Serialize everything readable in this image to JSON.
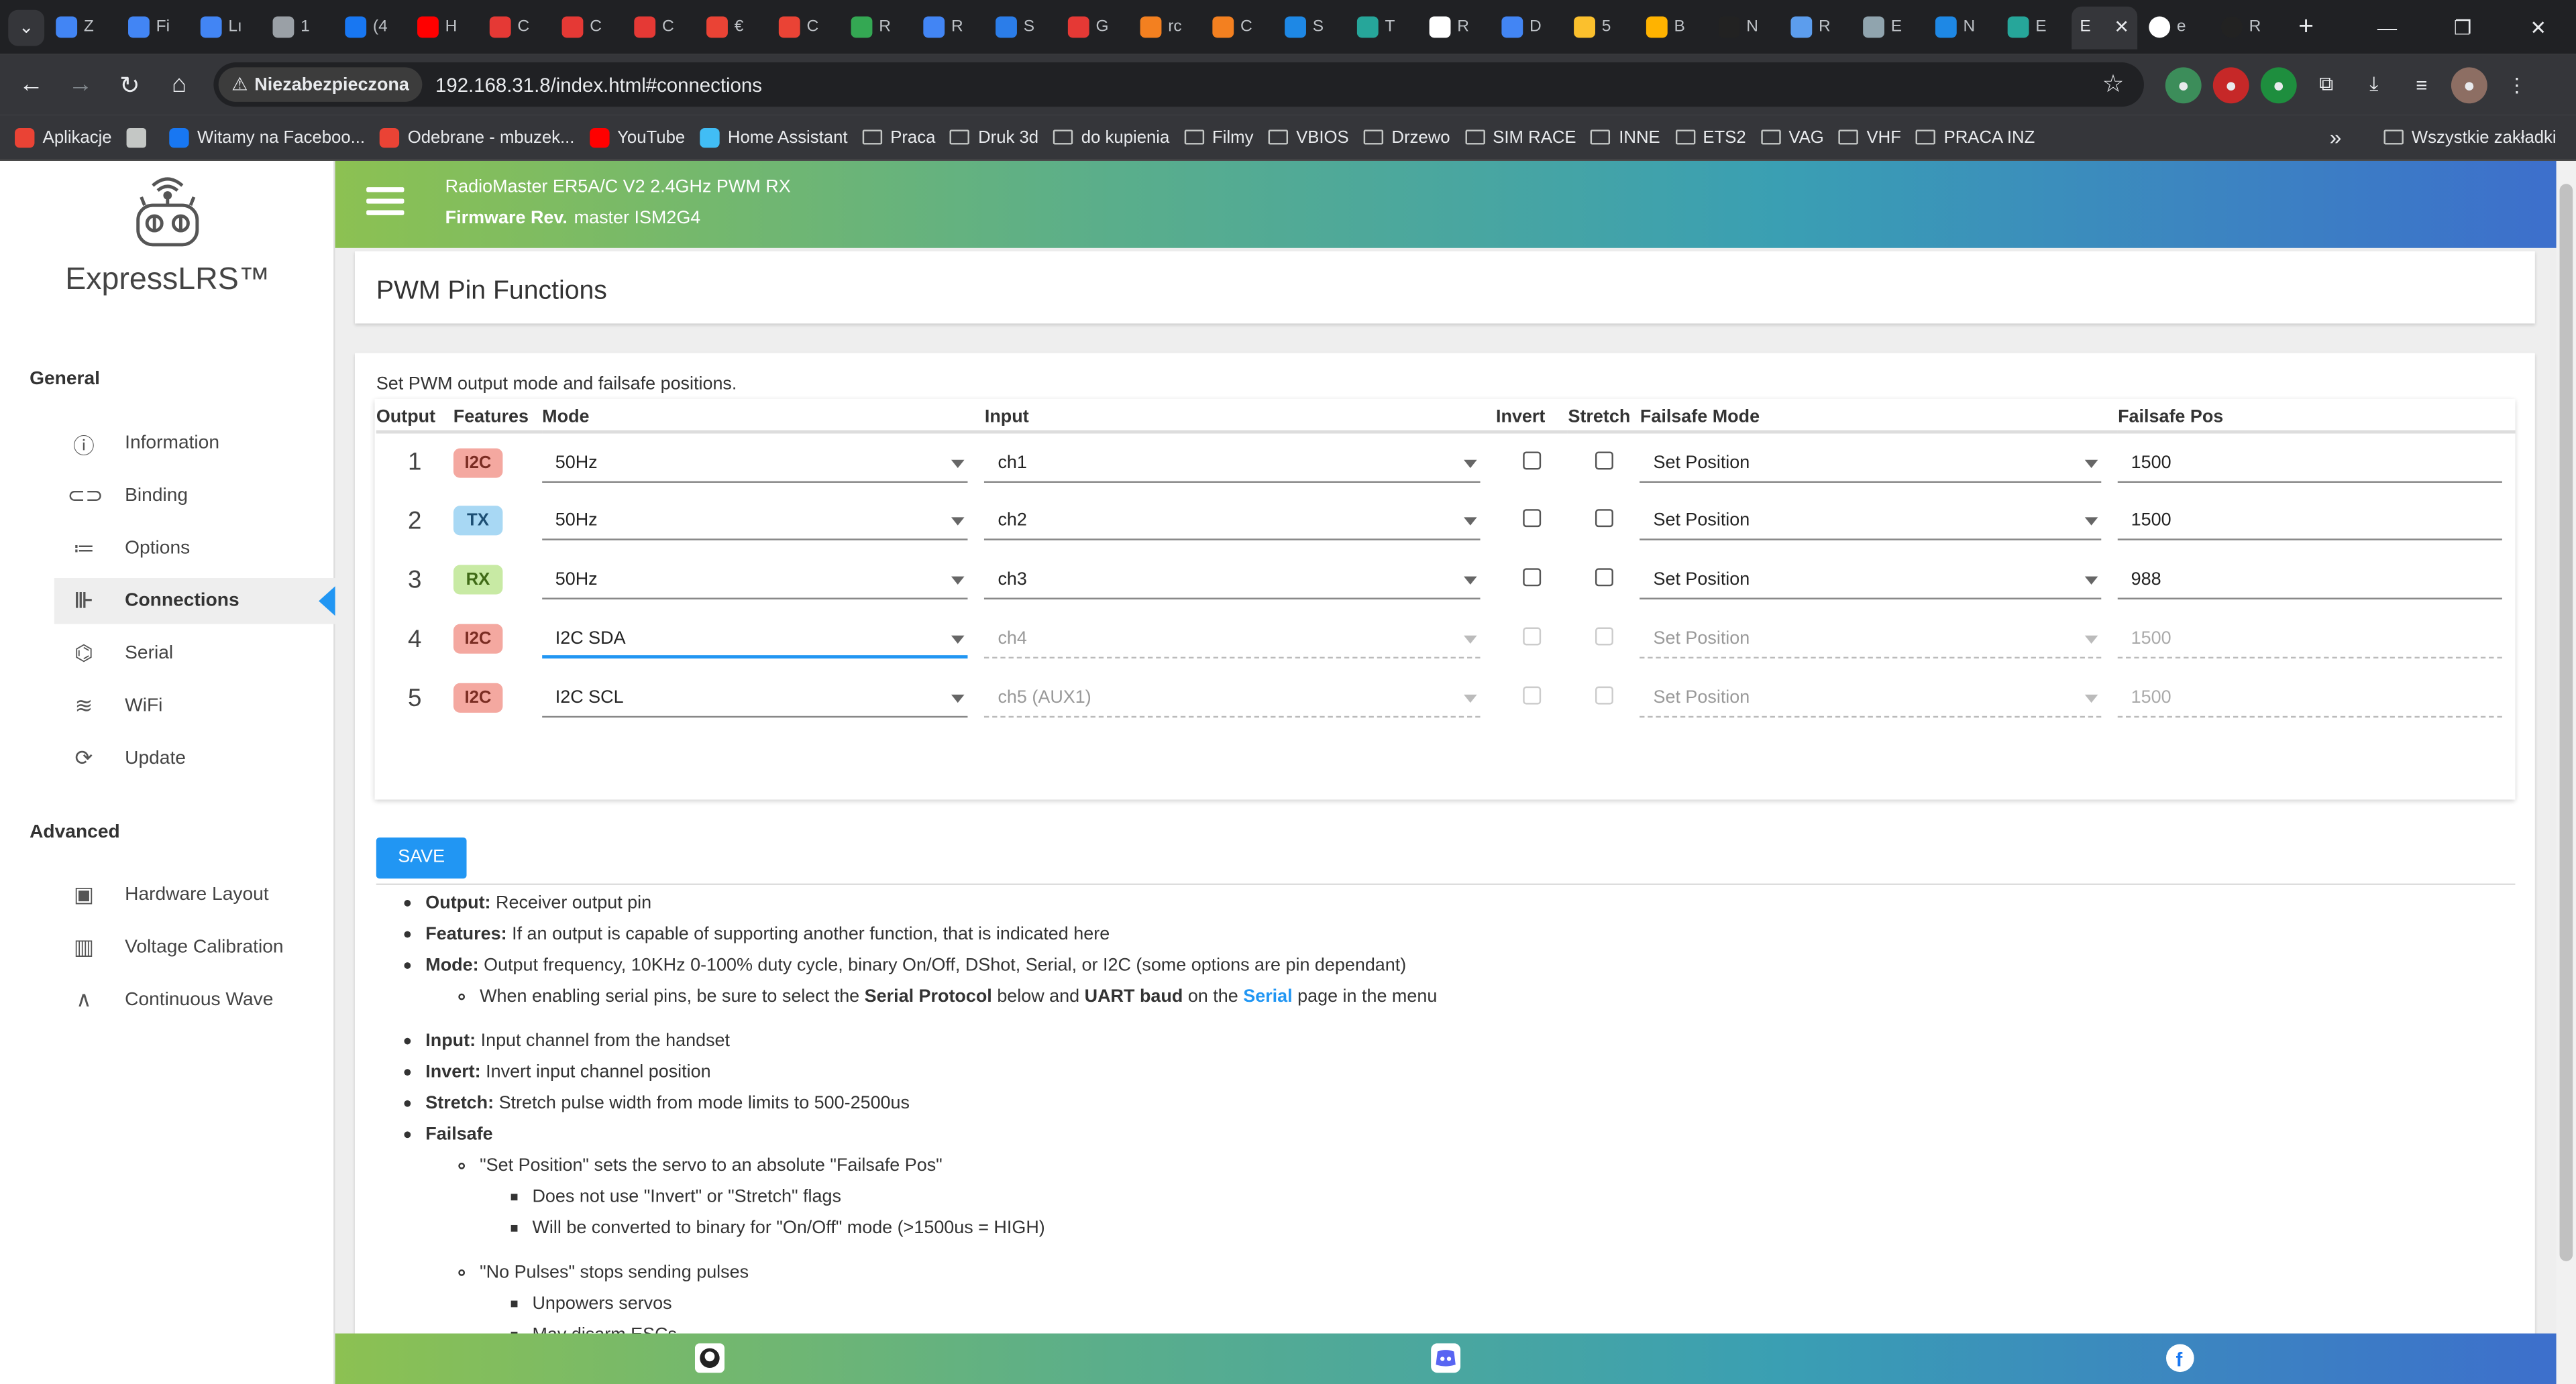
{
  "browser": {
    "tabs": [
      {
        "label": "Z",
        "color": "#4285f4"
      },
      {
        "label": "Fi",
        "color": "#4285f4"
      },
      {
        "label": "Lı",
        "color": "#4285f4"
      },
      {
        "label": "1",
        "color": "#9aa0a6"
      },
      {
        "label": "(4",
        "color": "#1877f2"
      },
      {
        "label": "H",
        "color": "#ff0000"
      },
      {
        "label": "C",
        "color": "#e53935"
      },
      {
        "label": "C",
        "color": "#e53935"
      },
      {
        "label": "C",
        "color": "#e53935"
      },
      {
        "label": "€",
        "color": "#ea4335"
      },
      {
        "label": "C",
        "color": "#ea4335"
      },
      {
        "label": "R",
        "color": "#34a853"
      },
      {
        "label": "R",
        "color": "#4285f4"
      },
      {
        "label": "S",
        "color": "#2b7de9"
      },
      {
        "label": "G",
        "color": "#e53935"
      },
      {
        "label": "rc",
        "color": "#f38020"
      },
      {
        "label": "C",
        "color": "#f38020"
      },
      {
        "label": "S",
        "color": "#1e88e5"
      },
      {
        "label": "T",
        "color": "#26a69a"
      },
      {
        "label": "R",
        "color": "#ffffff"
      },
      {
        "label": "D",
        "color": "#4285f4"
      },
      {
        "label": "5",
        "color": "#fbc02d"
      },
      {
        "label": "B",
        "color": "#ffb300"
      },
      {
        "label": "N",
        "color": "#222222"
      },
      {
        "label": "R",
        "color": "#5c9ded"
      },
      {
        "label": "E",
        "color": "#90a4ae"
      },
      {
        "label": "N",
        "color": "#1e88e5"
      },
      {
        "label": "E",
        "color": "#26a69a"
      }
    ],
    "active_tab": {
      "label": "E",
      "close": "✕"
    },
    "after_tabs": [
      {
        "label": "e",
        "color": "#ffffff"
      },
      {
        "label": "R",
        "color": "#222222"
      }
    ],
    "new_tab": "+",
    "window_controls": [
      "—",
      "❐",
      "✕"
    ],
    "security_label": "Niezabezpieczona",
    "url": "192.168.31.8/index.html#connections",
    "bookmarks": [
      {
        "label": "Aplikacje",
        "icon": "apps-icon"
      },
      {
        "label": "",
        "icon": "grid-icon"
      },
      {
        "label": "Witamy na Faceboo...",
        "icon": "facebook-icon"
      },
      {
        "label": "Odebrane - mbuzek...",
        "icon": "gmail-icon"
      },
      {
        "label": "YouTube",
        "icon": "youtube-icon"
      },
      {
        "label": "Home Assistant",
        "icon": "home-assistant-icon"
      },
      {
        "label": "Praca",
        "icon": "folder-icon"
      },
      {
        "label": "Druk 3d",
        "icon": "folder-icon"
      },
      {
        "label": "do kupienia",
        "icon": "folder-icon"
      },
      {
        "label": "Filmy",
        "icon": "folder-icon"
      },
      {
        "label": "VBIOS",
        "icon": "folder-icon"
      },
      {
        "label": "Drzewo",
        "icon": "folder-icon"
      },
      {
        "label": "SIM RACE",
        "icon": "folder-icon"
      },
      {
        "label": "INNE",
        "icon": "folder-icon"
      },
      {
        "label": "ETS2",
        "icon": "folder-icon"
      },
      {
        "label": "VAG",
        "icon": "folder-icon"
      },
      {
        "label": "VHF",
        "icon": "folder-icon"
      },
      {
        "label": "PRACA INZ",
        "icon": "folder-icon"
      }
    ],
    "bookmarks_more": "»",
    "all_bookmarks": "Wszystkie zakładki"
  },
  "sidebar": {
    "brand": "ExpressLRS™",
    "general_label": "General",
    "general": [
      {
        "label": "Information",
        "icon": "info-icon"
      },
      {
        "label": "Binding",
        "icon": "link-icon"
      },
      {
        "label": "Options",
        "icon": "options-list-icon"
      },
      {
        "label": "Connections",
        "icon": "connections-icon"
      },
      {
        "label": "Serial",
        "icon": "serial-icon"
      },
      {
        "label": "WiFi",
        "icon": "wifi-icon"
      },
      {
        "label": "Update",
        "icon": "update-icon"
      }
    ],
    "advanced_label": "Advanced",
    "advanced": [
      {
        "label": "Hardware Layout",
        "icon": "chip-icon"
      },
      {
        "label": "Voltage Calibration",
        "icon": "voltage-icon"
      },
      {
        "label": "Continuous Wave",
        "icon": "wave-icon"
      }
    ]
  },
  "header": {
    "device": "RadioMaster ER5A/C V2 2.4GHz PWM RX",
    "firmware_label": "Firmware Rev.",
    "firmware_value": "master ISM2G4"
  },
  "main": {
    "title": "PWM Pin Functions",
    "description": "Set PWM output mode and failsafe positions.",
    "columns": [
      "Output",
      "Features",
      "Mode",
      "Input",
      "Invert",
      "Stretch",
      "Failsafe Mode",
      "Failsafe Pos"
    ],
    "rows": [
      {
        "output": "1",
        "feature": "I2C",
        "mode": "50Hz",
        "input": "ch1",
        "failsafe_mode": "Set Position",
        "failsafe_pos": "1500"
      },
      {
        "output": "2",
        "feature": "TX",
        "mode": "50Hz",
        "input": "ch2",
        "failsafe_mode": "Set Position",
        "failsafe_pos": "1500"
      },
      {
        "output": "3",
        "feature": "RX",
        "mode": "50Hz",
        "input": "ch3",
        "failsafe_mode": "Set Position",
        "failsafe_pos": "988"
      },
      {
        "output": "4",
        "feature": "I2C",
        "mode": "I2C SDA",
        "input": "ch4",
        "failsafe_mode": "Set Position",
        "failsafe_pos": "1500"
      },
      {
        "output": "5",
        "feature": "I2C",
        "mode": "I2C SCL",
        "input": "ch5 (AUX1)",
        "failsafe_mode": "Set Position",
        "failsafe_pos": "1500"
      }
    ],
    "save_label": "SAVE"
  },
  "help": {
    "output_b": "Output:",
    "output_t": "Receiver output pin",
    "features_b": "Features:",
    "features_t": "If an output is capable of supporting another function, that is indicated here",
    "mode_b": "Mode:",
    "mode_t": "Output frequency, 10KHz 0-100% duty cycle, binary On/Off, DShot, Serial, or I2C (some options are pin dependant)",
    "serial_1": "When enabling serial pins, be sure to select the",
    "serial_b1": "Serial Protocol",
    "serial_2": "below and",
    "serial_b2": "UART baud",
    "serial_3": "on the",
    "serial_link": "Serial",
    "serial_4": "page in the menu",
    "input_b": "Input:",
    "input_t": "Input channel from the handset",
    "invert_b": "Invert:",
    "invert_t": "Invert input channel position",
    "stretch_b": "Stretch:",
    "stretch_t": "Stretch pulse width from mode limits to 500-2500us",
    "failsafe_b": "Failsafe",
    "fs_set": "\"Set Position\" sets the servo to an absolute \"Failsafe Pos\"",
    "fs_set_1": "Does not use \"Invert\" or \"Stretch\" flags",
    "fs_set_2": "Will be converted to binary for \"On/Off\" mode (>1500us = HIGH)",
    "fs_np": "\"No Pulses\" stops sending pulses",
    "fs_np_1": "Unpowers servos",
    "fs_np_2": "May disarm ESCs"
  },
  "footer": {
    "icons": [
      "github-icon",
      "discord-icon",
      "facebook-icon"
    ]
  }
}
